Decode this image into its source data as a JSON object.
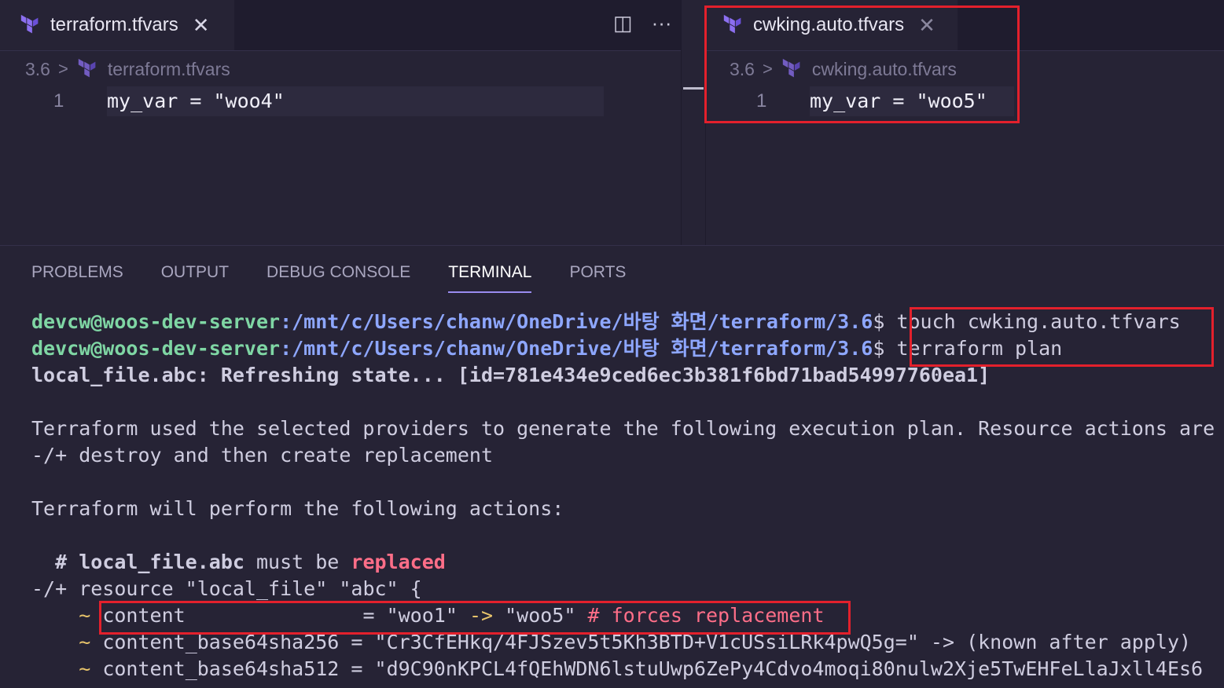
{
  "editor": {
    "left": {
      "tab_label": "terraform.tfvars",
      "close_glyph": "✕",
      "breadcrumb_folder": "3.6",
      "breadcrumb_file": "terraform.tfvars",
      "line_number": "1",
      "code": "my_var = \"woo4\""
    },
    "right": {
      "tab_label": "cwking.auto.tfvars",
      "close_glyph": "✕",
      "breadcrumb_folder": "3.6",
      "breadcrumb_file": "cwking.auto.tfvars",
      "line_number": "1",
      "code": "my_var = \"woo5\""
    },
    "toolbar": {
      "split_icon": "split-editor-icon",
      "more_icon": "more-actions-icon"
    }
  },
  "panel": {
    "tabs": [
      {
        "label": "PROBLEMS"
      },
      {
        "label": "OUTPUT"
      },
      {
        "label": "DEBUG CONSOLE"
      },
      {
        "label": "TERMINAL",
        "active": true
      },
      {
        "label": "PORTS"
      }
    ]
  },
  "terminal": {
    "prompt_user": "devcw@woos-dev-server",
    "prompt_path": ":/mnt/c/Users/chanw/OneDrive/바탕 화면/terraform/3.6",
    "prompt_symbol": "$",
    "cmd1": " touch cwking.auto.tfvars",
    "cmd2": " terraform plan",
    "line_refresh": "local_file.abc: Refreshing state... [id=781e434e9ced6ec3b381f6bd71bad54997760ea1]",
    "line_used": "Terraform used the selected providers to generate the following execution plan. Resource actions are",
    "line_symbol": "-/+",
    "line_destroy": " destroy and then create replacement",
    "line_perform": "Terraform will perform the following actions:",
    "comment_hash": "  # ",
    "comment_resource": "local_file.abc",
    "comment_must": " must be ",
    "comment_replaced": "replaced",
    "resource_symbol": "-/+",
    "resource_line": " resource \"local_file\" \"abc\" {",
    "tilde": "~",
    "attr1_name": " content              ",
    "attr1_value": " = \"woo1\" ",
    "attr1_arrow": "->",
    "attr1_new": " \"woo5\" ",
    "attr1_comment": "# forces replacement",
    "attr2": " content_base64sha256 = \"Cr3CfEHkq/4FJSzev5t5Kh3BTD+V1cUSsiLRk4pwQ5g=\" -> (known after apply)",
    "attr3": " content_base64sha512 = \"d9C90nKPCL4fQEhWDN6lstuUwp6ZePy4Cdvo4moqi80nulw2Xje5TwEHFeLlaJxll4Es6"
  },
  "colors": {
    "background": "#262335",
    "highlight": "#e3202c",
    "prompt_user": "#7fd6a4",
    "prompt_path": "#8ea7ff",
    "replaced": "#ff6e88",
    "tilde": "#e8c46b"
  }
}
